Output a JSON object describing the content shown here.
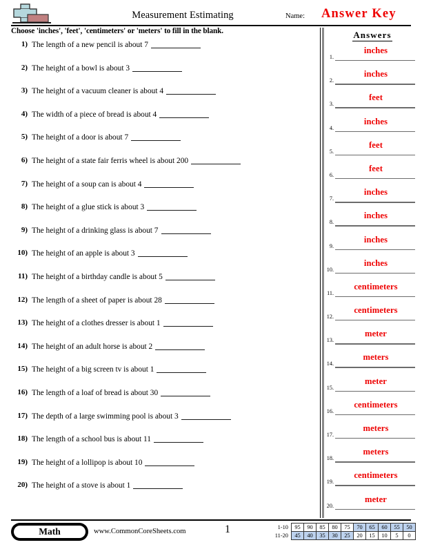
{
  "header": {
    "title": "Measurement Estimating",
    "name_label": "Name:",
    "answer_key": "Answer Key",
    "logo_name": "math-plus-logo"
  },
  "instruction": "Choose 'inches', 'feet', 'centimeters' or 'meters' to fill in the blank.",
  "questions": [
    {
      "num": "1)",
      "text": "The length of a new pencil is about 7"
    },
    {
      "num": "2)",
      "text": "The height of a bowl is about 3"
    },
    {
      "num": "3)",
      "text": "The height of a vacuum cleaner is about 4"
    },
    {
      "num": "4)",
      "text": "The width of a piece of bread is about 4"
    },
    {
      "num": "5)",
      "text": "The height of a door is about 7"
    },
    {
      "num": "6)",
      "text": "The height of a state fair ferris wheel is about 200"
    },
    {
      "num": "7)",
      "text": "The height of a soup can is about 4"
    },
    {
      "num": "8)",
      "text": "The height of a glue stick is about 3"
    },
    {
      "num": "9)",
      "text": "The height of a drinking glass is about 7"
    },
    {
      "num": "10)",
      "text": "The height of an apple is about 3"
    },
    {
      "num": "11)",
      "text": "The height of a birthday candle is about 5"
    },
    {
      "num": "12)",
      "text": "The length of a sheet of paper is about 28"
    },
    {
      "num": "13)",
      "text": "The height of a clothes dresser is about 1"
    },
    {
      "num": "14)",
      "text": "The height of an adult horse is about 2"
    },
    {
      "num": "15)",
      "text": "The height of a big screen tv is about 1"
    },
    {
      "num": "16)",
      "text": "The length of a loaf of bread is about 30"
    },
    {
      "num": "17)",
      "text": "The depth of a large swimming pool is about 3"
    },
    {
      "num": "18)",
      "text": "The length of a school bus is about 11"
    },
    {
      "num": "19)",
      "text": "The height of a lollipop is about 10"
    },
    {
      "num": "20)",
      "text": "The height of a stove is about 1"
    }
  ],
  "answers": {
    "heading": "Answers",
    "color": "#ee0000",
    "items": [
      {
        "num": "1.",
        "value": "inches"
      },
      {
        "num": "2.",
        "value": "inches"
      },
      {
        "num": "3.",
        "value": "feet"
      },
      {
        "num": "4.",
        "value": "inches"
      },
      {
        "num": "5.",
        "value": "feet"
      },
      {
        "num": "6.",
        "value": "feet"
      },
      {
        "num": "7.",
        "value": "inches"
      },
      {
        "num": "8.",
        "value": "inches"
      },
      {
        "num": "9.",
        "value": "inches"
      },
      {
        "num": "10.",
        "value": "inches"
      },
      {
        "num": "11.",
        "value": "centimeters"
      },
      {
        "num": "12.",
        "value": "centimeters"
      },
      {
        "num": "13.",
        "value": "meter"
      },
      {
        "num": "14.",
        "value": "meters"
      },
      {
        "num": "15.",
        "value": "meter"
      },
      {
        "num": "16.",
        "value": "centimeters"
      },
      {
        "num": "17.",
        "value": "meters"
      },
      {
        "num": "18.",
        "value": "meters"
      },
      {
        "num": "19.",
        "value": "centimeters"
      },
      {
        "num": "20.",
        "value": "meter"
      }
    ]
  },
  "footer": {
    "subject_badge": "Math",
    "site_url": "www.CommonCoreSheets.com",
    "page_number": "1"
  },
  "score_table": {
    "shade_color": "#bdd2ee",
    "rows": [
      {
        "label": "1-10",
        "cells": [
          {
            "value": "95",
            "shaded": false
          },
          {
            "value": "90",
            "shaded": false
          },
          {
            "value": "85",
            "shaded": false
          },
          {
            "value": "80",
            "shaded": false
          },
          {
            "value": "75",
            "shaded": false
          },
          {
            "value": "70",
            "shaded": true
          },
          {
            "value": "65",
            "shaded": true
          },
          {
            "value": "60",
            "shaded": true
          },
          {
            "value": "55",
            "shaded": true
          },
          {
            "value": "50",
            "shaded": true
          }
        ]
      },
      {
        "label": "11-20",
        "cells": [
          {
            "value": "45",
            "shaded": true
          },
          {
            "value": "40",
            "shaded": true
          },
          {
            "value": "35",
            "shaded": true
          },
          {
            "value": "30",
            "shaded": true
          },
          {
            "value": "25",
            "shaded": true
          },
          {
            "value": "20",
            "shaded": false
          },
          {
            "value": "15",
            "shaded": false
          },
          {
            "value": "10",
            "shaded": false
          },
          {
            "value": "5",
            "shaded": false
          },
          {
            "value": "0",
            "shaded": false
          }
        ]
      }
    ]
  }
}
